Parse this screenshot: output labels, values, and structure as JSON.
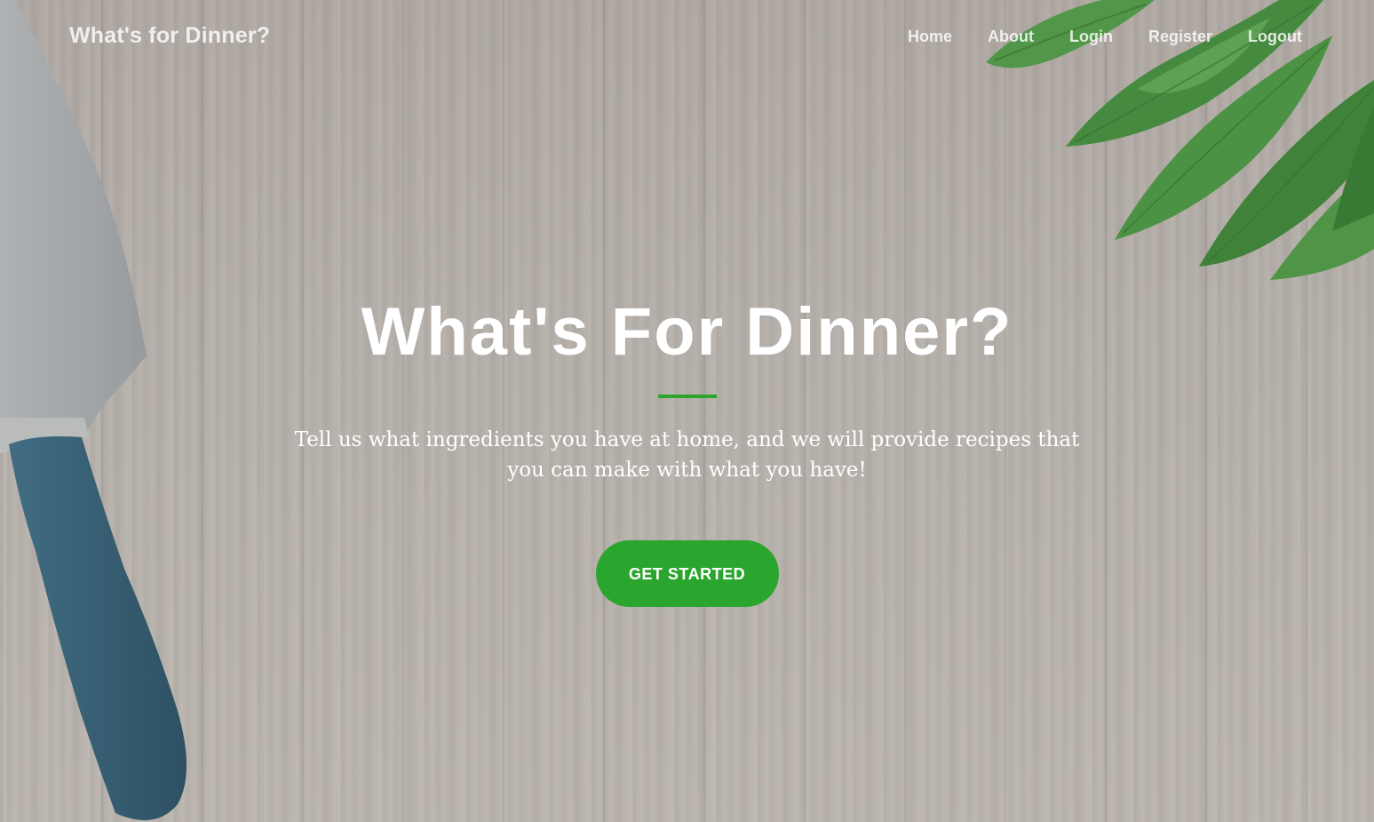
{
  "nav": {
    "brand": "What's for Dinner?",
    "links": [
      "Home",
      "About",
      "Login",
      "Register",
      "Logout"
    ]
  },
  "hero": {
    "title": "What's For Dinner?",
    "subtitle": "Tell us what ingredients you have at home, and we will provide recipes that you can make with what you have!",
    "cta_label": "GET STARTED"
  },
  "colors": {
    "accent": "#2aa52e",
    "knife_handle": "#2d5a73",
    "knife_blade": "#a9aeb2",
    "leaves": "#3f8f3a"
  },
  "icons": [
    "knife-image",
    "leaves-image"
  ]
}
